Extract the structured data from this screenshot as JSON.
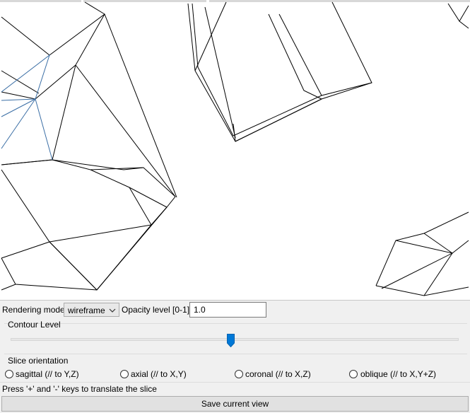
{
  "rendering": {
    "label": "Rendering mode",
    "value": "wireframe"
  },
  "opacity": {
    "label": "Opacity level [0-1]",
    "value": "1.0"
  },
  "contour": {
    "label": "Contour Level",
    "slider_value": 0.49
  },
  "slice": {
    "label": "Slice orientation",
    "options": [
      {
        "label": "sagittal (// to Y,Z)",
        "checked": false
      },
      {
        "label": "axial (// to X,Y)",
        "checked": false
      },
      {
        "label": "coronal (// to X,Z)",
        "checked": false
      },
      {
        "label": "oblique (// to X,Y+Z)",
        "checked": false
      }
    ]
  },
  "hint": "Press '+' and '-' keys to translate the slice",
  "save_label": "Save current view",
  "colors": {
    "mesh": "#000000",
    "mesh_highlight": "#3a6ea5",
    "slider_thumb": "#0078d7"
  }
}
